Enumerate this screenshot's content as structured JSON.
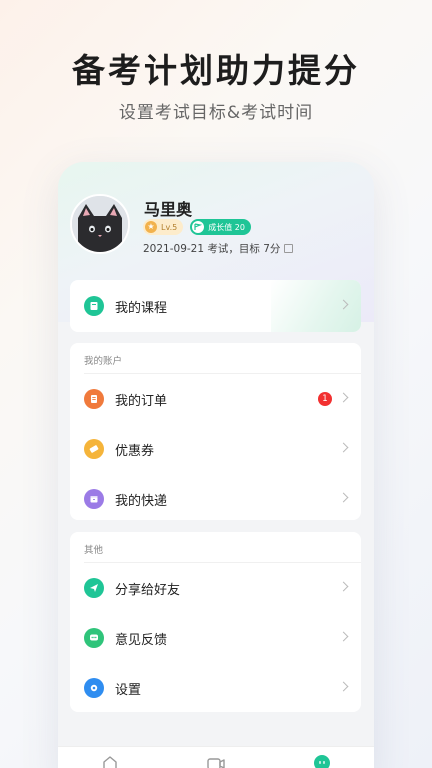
{
  "promo": {
    "headline": "备考计划助力提分",
    "subline": "设置考试目标&考试时间"
  },
  "profile": {
    "username": "马里奥",
    "level_badge": "Lv.5",
    "growth_badge": "成长值 20",
    "exam_info": "2021-09-21 考试，目标 7分"
  },
  "course": {
    "label": "我的课程"
  },
  "account": {
    "section_title": "我的账户",
    "items": [
      {
        "label": "我的订单",
        "badge": "1",
        "icon": "order-icon",
        "color": "#f07a3c"
      },
      {
        "label": "优惠券",
        "icon": "coupon-icon",
        "color": "#f5b43a"
      },
      {
        "label": "我的快递",
        "icon": "delivery-icon",
        "color": "#9b7be6"
      }
    ]
  },
  "other": {
    "section_title": "其他",
    "items": [
      {
        "label": "分享给好友",
        "icon": "share-icon",
        "color": "#1fc596"
      },
      {
        "label": "意见反馈",
        "icon": "feedback-icon",
        "color": "#2fc47a"
      },
      {
        "label": "设置",
        "icon": "settings-icon",
        "color": "#2f8df0"
      }
    ]
  },
  "tabbar": {
    "tabs": [
      {
        "icon": "home-icon"
      },
      {
        "icon": "video-icon"
      },
      {
        "icon": "profile-icon",
        "active": true
      }
    ],
    "active_color": "#1fc596"
  },
  "colors": {
    "brand_green": "#1fc596",
    "badge_red": "#f23030"
  }
}
